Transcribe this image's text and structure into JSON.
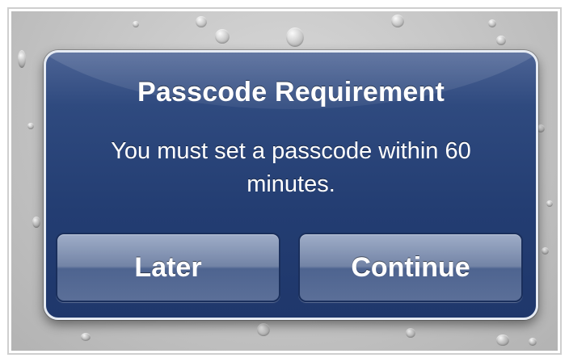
{
  "alert": {
    "title": "Passcode Requirement",
    "message": "You must set a passcode within 60 minutes.",
    "buttons": {
      "later": "Later",
      "continue": "Continue"
    }
  },
  "colors": {
    "alert_background": "#233d72",
    "alert_border": "#e6ebf3",
    "wallpaper": "#c4c4c4",
    "button_top": "#9fadc8",
    "button_bottom": "#4e6490"
  }
}
